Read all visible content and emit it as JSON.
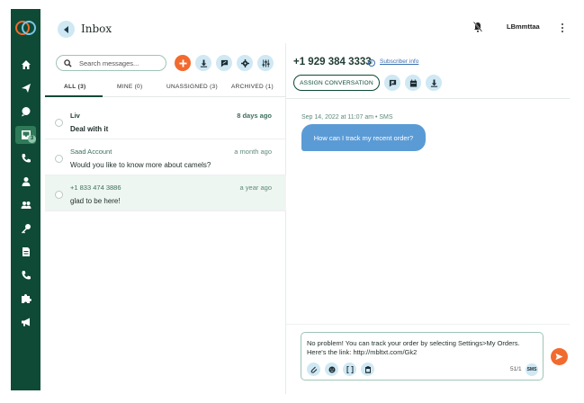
{
  "header": {
    "title": "Inbox",
    "username": "LBmmttaa"
  },
  "sidebar": {
    "items": [
      {
        "icon": "home-icon"
      },
      {
        "icon": "send-icon"
      },
      {
        "icon": "chat-icon"
      },
      {
        "icon": "inbox-icon",
        "badge": "3"
      },
      {
        "icon": "phone-icon"
      },
      {
        "icon": "contact-icon"
      },
      {
        "icon": "team-icon"
      },
      {
        "icon": "key-icon"
      },
      {
        "icon": "document-icon"
      },
      {
        "icon": "call-log-icon"
      },
      {
        "icon": "puzzle-icon"
      },
      {
        "icon": "megaphone-icon"
      }
    ]
  },
  "search": {
    "placeholder": "Search messages..."
  },
  "tabs": [
    {
      "label": "ALL",
      "count": "(3)"
    },
    {
      "label": "MINE",
      "count": "(0)"
    },
    {
      "label": "UNASSIGNED",
      "count": "(3)"
    },
    {
      "label": "ARCHIVED",
      "count": "(1)"
    }
  ],
  "conversations": [
    {
      "name": "Liv",
      "time": "8 days ago",
      "snippet": "Deal with it",
      "unread": true
    },
    {
      "name": "Saad Account",
      "time": "a month ago",
      "snippet": "Would you like to know more about camels?",
      "unread": false
    },
    {
      "name": "+1 833 474 3886",
      "time": "a year ago",
      "snippet": "glad to be here!",
      "unread": false
    }
  ],
  "thread": {
    "phone": "+1 929 384 3333",
    "subscriber_link": "Subscriber info",
    "assign_label": "ASSIGN CONVERSATION",
    "meta": "Sep 14, 2022 at 11:07 am • SMS",
    "message": "How can I track my recent order?"
  },
  "composer": {
    "text": "No problem! You can track your order by selecting Settings>My Orders. Here's the link: http://mbltxt.com/Gk2",
    "char_count": "51/1",
    "channel": "SMS"
  },
  "colors": {
    "sidebar": "#0e4a36",
    "accent_orange": "#f26a2e",
    "bubble_blue": "#5b9bd5",
    "chip_blue": "#cfe8f3"
  }
}
